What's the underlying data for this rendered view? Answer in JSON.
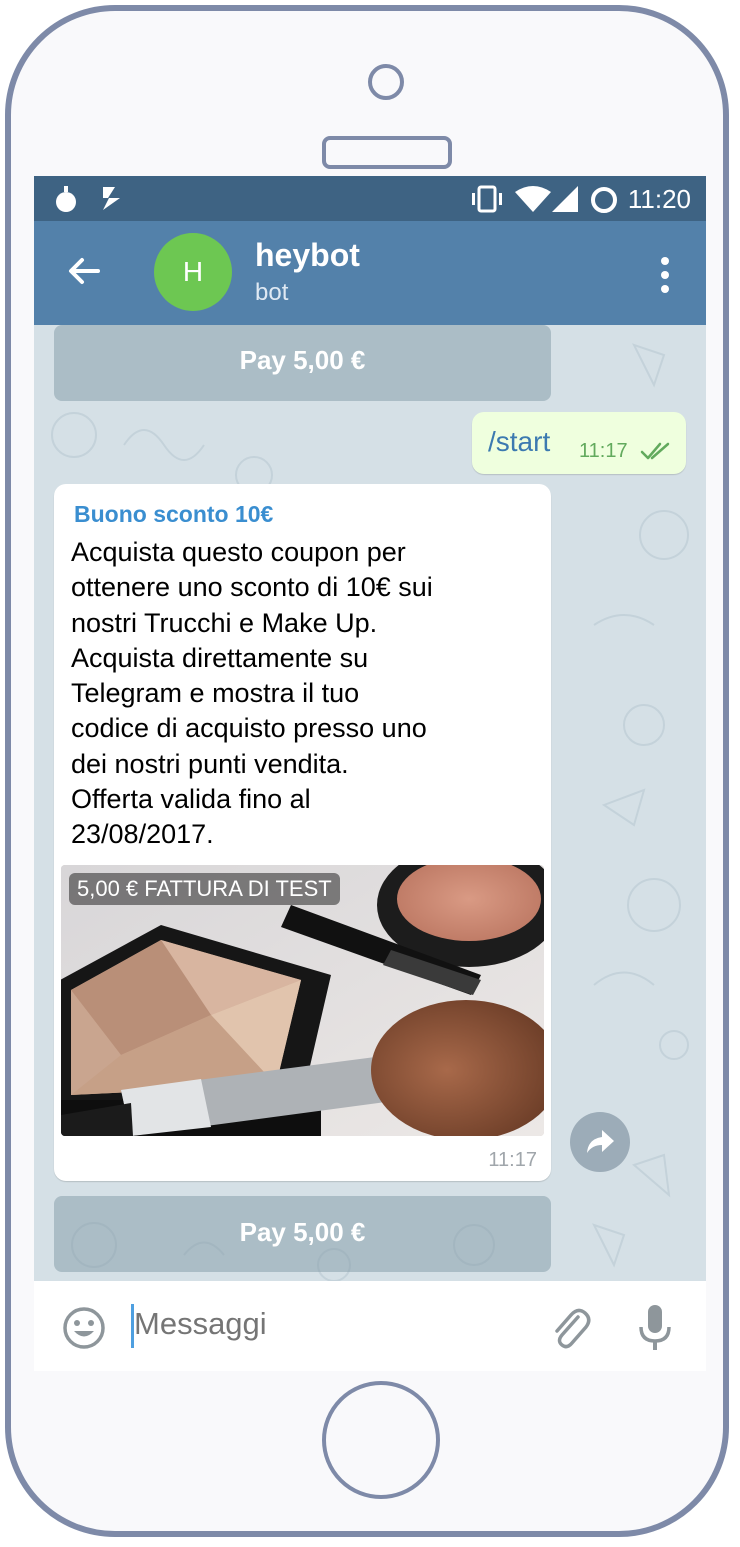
{
  "status_bar": {
    "time": "11:20",
    "icons": [
      "timer-app-icon",
      "download-icon",
      "vibrate-icon",
      "wifi-icon",
      "signal-icon",
      "battery-icon"
    ]
  },
  "header": {
    "avatar_letter": "H",
    "title": "heybot",
    "subtitle": "bot",
    "colors": {
      "status_bar": "#3e6383",
      "app_bar": "#5381aa",
      "avatar": "#6dc752"
    }
  },
  "chat": {
    "pay_button_top": "Pay 5,00 €",
    "outgoing": {
      "text": "/start",
      "time": "11:17",
      "status": "read"
    },
    "invoice": {
      "title": "Buono sconto 10€",
      "description": "Acquista questo coupon per\nottenere uno sconto di 10€ sui\nnostri Trucchi e Make Up.\nAcquista direttamente su\nTelegram e mostra il tuo\ncodice di acquisto presso uno\ndei nostri punti vendita.\nOfferta valida fino al\n23/08/2017.",
      "badge": "5,00 € FATTURA DI TEST",
      "time": "11:17"
    },
    "pay_button_bottom": "Pay 5,00 €"
  },
  "input": {
    "placeholder": "Messaggi"
  }
}
